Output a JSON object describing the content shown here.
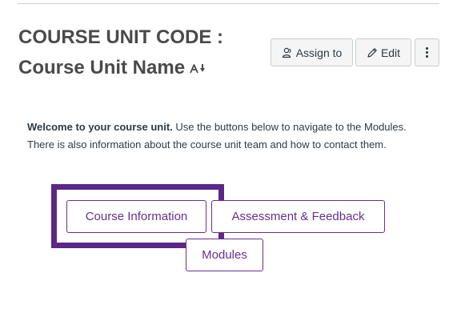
{
  "page": {
    "title_line1": "COURSE UNIT CODE :",
    "title_line2": "Course Unit Name",
    "sort_icon": "sort-arrow-icon"
  },
  "toolbar": {
    "assign_label": "Assign to",
    "assign_icon": "users-icon",
    "edit_label": "Edit",
    "edit_icon": "pencil-icon",
    "more_icon": "more-options-icon"
  },
  "welcome": {
    "lead": "Welcome to your course unit.",
    "body": " Use the buttons below to navigate to the Modules. There is also information about the course unit team and how to contact them."
  },
  "nav_buttons": {
    "course_information": "Course Information",
    "assessment_feedback": "Assessment & Feedback",
    "modules": "Modules"
  },
  "colors": {
    "text": "#2d3b45",
    "title": "#4a4a4a",
    "accent_purple": "#6a2e8f",
    "highlight_box": "#5b2788",
    "button_bg": "#f5f5f5",
    "border": "#c7cdd1"
  }
}
